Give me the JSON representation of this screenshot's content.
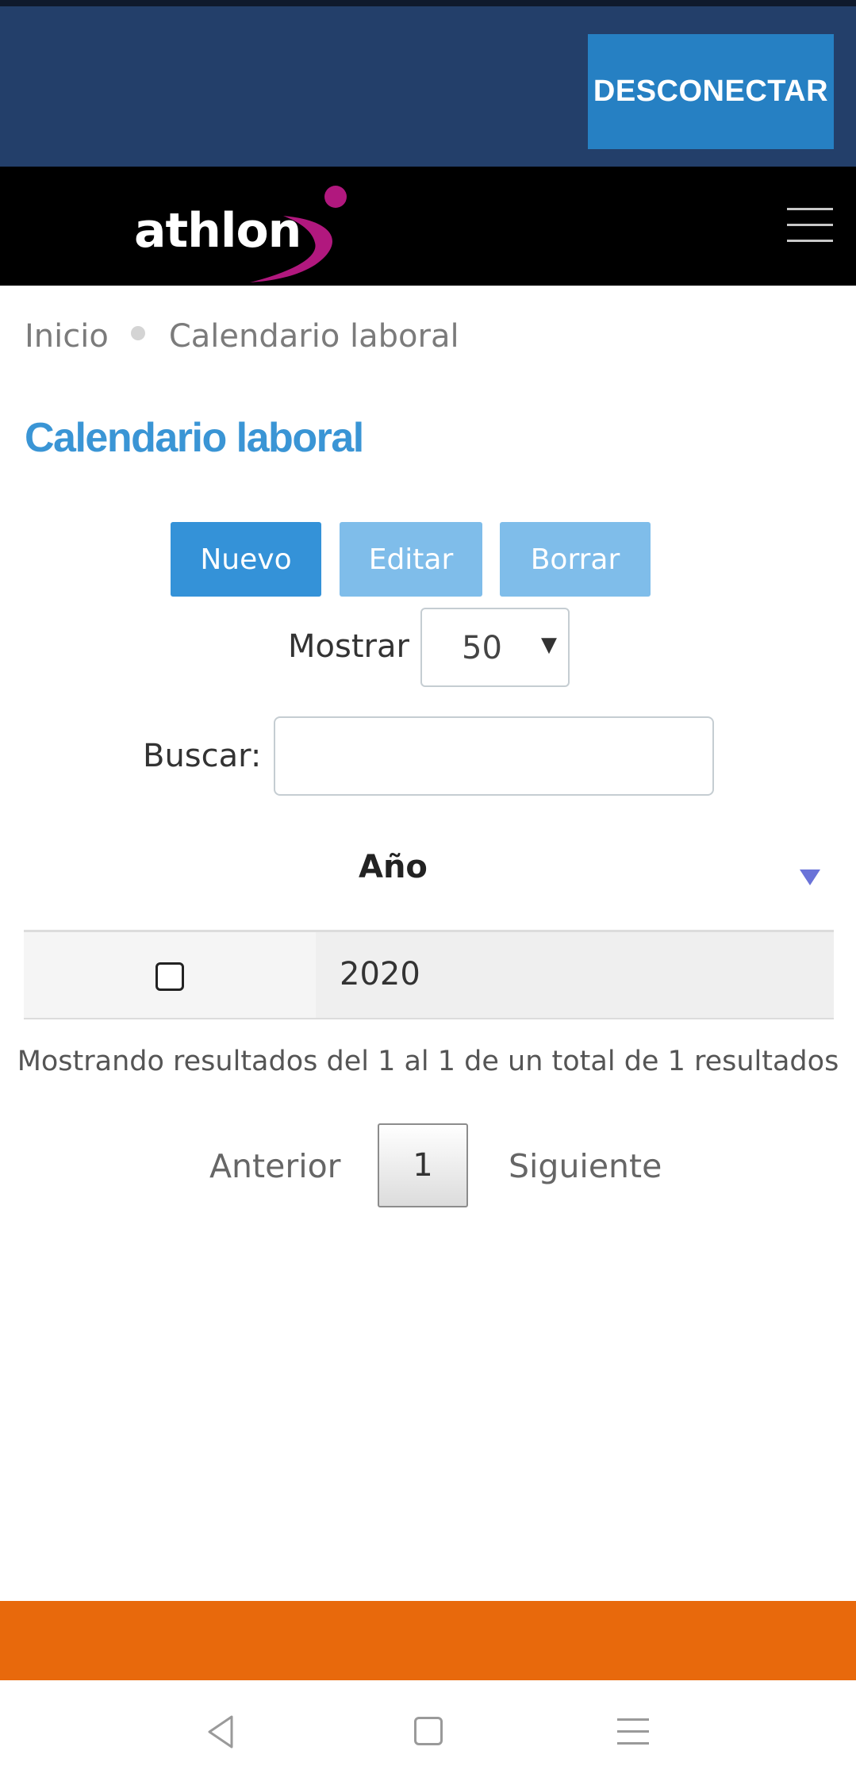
{
  "header": {
    "disconnect_label": "DESCONECTAR",
    "logo_text": "athlon",
    "menu_icon": "hamburger-icon"
  },
  "breadcrumb": {
    "home": "Inicio",
    "current": "Calendario laboral"
  },
  "page": {
    "title": "Calendario laboral"
  },
  "toolbar": {
    "new_label": "Nuevo",
    "edit_label": "Editar",
    "delete_label": "Borrar"
  },
  "length": {
    "label": "Mostrar",
    "selected": "50"
  },
  "search": {
    "label": "Buscar:",
    "value": ""
  },
  "table": {
    "columns": [
      "Año"
    ],
    "rows": [
      {
        "checked": false,
        "year": "2020"
      }
    ]
  },
  "info": "Mostrando resultados del 1 al 1 de un total de 1 resultados",
  "pagination": {
    "previous": "Anterior",
    "current_page": "1",
    "next": "Siguiente"
  },
  "colors": {
    "top_bar": "#233f6a",
    "disconnect": "#2680c3",
    "title": "#3a95d5",
    "primary_button": "#3492d8",
    "disabled_button": "#7fbdea",
    "footer": "#e8690c",
    "logo_accent": "#b1187e"
  }
}
